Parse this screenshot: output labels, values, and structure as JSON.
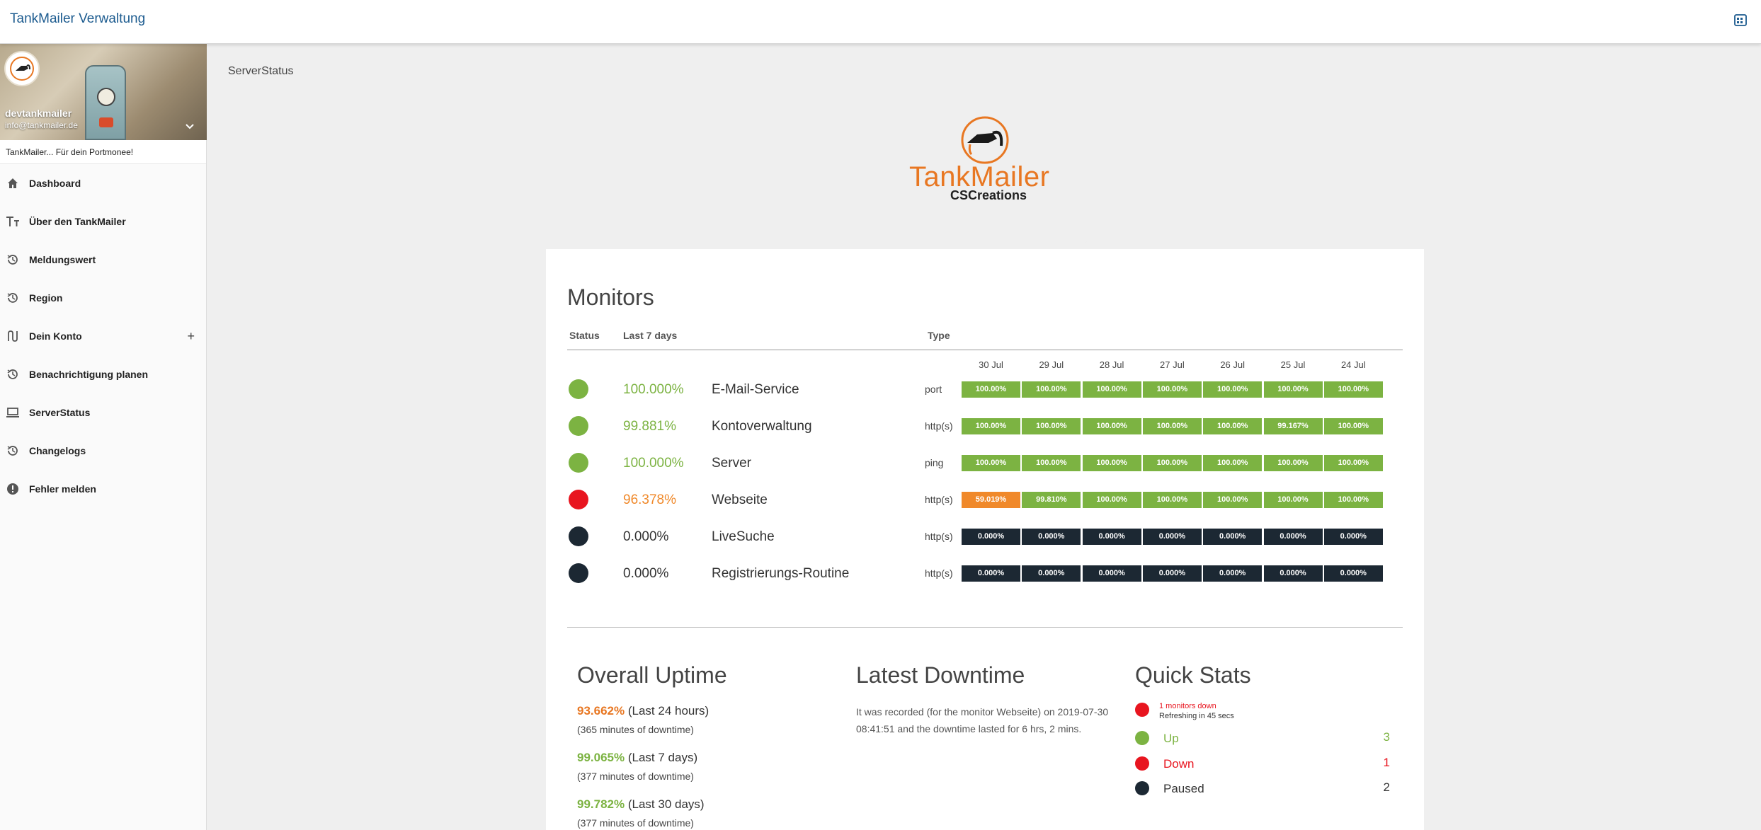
{
  "app": {
    "title": "TankMailer Verwaltung"
  },
  "profile": {
    "name": "devtankmailer",
    "email": "info@tankmailer.de",
    "tagline": "TankMailer... Für dein Portmonee!"
  },
  "sidebar": {
    "items": [
      {
        "label": "Dashboard",
        "icon": "home-icon"
      },
      {
        "label": "Über den TankMailer",
        "icon": "text-size-icon"
      },
      {
        "label": "Meldungswert",
        "icon": "history-icon"
      },
      {
        "label": "Region",
        "icon": "history-icon"
      },
      {
        "label": "Dein Konto",
        "icon": "route-icon",
        "expandable": true
      },
      {
        "label": "Benachrichtigung planen",
        "icon": "history-icon"
      },
      {
        "label": "ServerStatus",
        "icon": "laptop-icon"
      },
      {
        "label": "Changelogs",
        "icon": "history-icon"
      },
      {
        "label": "Fehler melden",
        "icon": "alert-circle-icon"
      }
    ]
  },
  "breadcrumb": "ServerStatus",
  "logo": {
    "text": "TankMailer",
    "sub": "CSCreations"
  },
  "monitors": {
    "title": "Monitors",
    "headers": {
      "status": "Status",
      "last7": "Last 7 days",
      "type": "Type"
    },
    "days": [
      "30 Jul",
      "29 Jul",
      "28 Jul",
      "27 Jul",
      "26 Jul",
      "25 Jul",
      "24 Jul"
    ],
    "rows": [
      {
        "status": "up",
        "uptime": "100.000%",
        "name": "E-Mail-Service",
        "type": "port",
        "days": [
          "100.00%",
          "100.00%",
          "100.00%",
          "100.00%",
          "100.00%",
          "100.00%",
          "100.00%"
        ]
      },
      {
        "status": "up",
        "uptime": "99.881%",
        "name": "Kontoverwaltung",
        "type": "http(s)",
        "days": [
          "100.00%",
          "100.00%",
          "100.00%",
          "100.00%",
          "100.00%",
          "99.167%",
          "100.00%"
        ]
      },
      {
        "status": "up",
        "uptime": "100.000%",
        "name": "Server",
        "type": "ping",
        "days": [
          "100.00%",
          "100.00%",
          "100.00%",
          "100.00%",
          "100.00%",
          "100.00%",
          "100.00%"
        ]
      },
      {
        "status": "down",
        "uptime": "96.378%",
        "name": "Webseite",
        "type": "http(s)",
        "days": [
          "59.019%",
          "99.810%",
          "100.00%",
          "100.00%",
          "100.00%",
          "100.00%",
          "100.00%"
        ]
      },
      {
        "status": "paused",
        "uptime": "0.000%",
        "name": "LiveSuche",
        "type": "http(s)",
        "days": [
          "0.000%",
          "0.000%",
          "0.000%",
          "0.000%",
          "0.000%",
          "0.000%",
          "0.000%"
        ]
      },
      {
        "status": "paused",
        "uptime": "0.000%",
        "name": "Registrierungs-Routine",
        "type": "http(s)",
        "days": [
          "0.000%",
          "0.000%",
          "0.000%",
          "0.000%",
          "0.000%",
          "0.000%",
          "0.000%"
        ]
      }
    ]
  },
  "overall_uptime": {
    "title": "Overall Uptime",
    "entries": [
      {
        "value": "93.662%",
        "period": "(Last 24 hours)",
        "note": "(365 minutes of downtime)",
        "color": "#e87722"
      },
      {
        "value": "99.065%",
        "period": "(Last 7 days)",
        "note": "(377 minutes of downtime)",
        "color": "#7cb342"
      },
      {
        "value": "99.782%",
        "period": "(Last 30 days)",
        "note": "(377 minutes of downtime)",
        "color": "#7cb342"
      }
    ]
  },
  "latest_downtime": {
    "title": "Latest Downtime",
    "text": "It was recorded (for the monitor Webseite) on 2019-07-30 08:41:51 and the downtime lasted for 6 hrs, 2 mins."
  },
  "quick_stats": {
    "title": "Quick Stats",
    "alert": "1 monitors down",
    "refresh": "Refreshing in 45 secs",
    "items": [
      {
        "label": "Up",
        "count": "3",
        "color": "#7cb342"
      },
      {
        "label": "Down",
        "count": "1",
        "color": "#e8151f"
      },
      {
        "label": "Paused",
        "count": "2",
        "color": "#1c2833"
      }
    ]
  },
  "colors": {
    "up": "#7cb342",
    "down": "#e8151f",
    "paused": "#1c2833",
    "warn": "#f0892a",
    "brand": "#1c5b8f"
  }
}
